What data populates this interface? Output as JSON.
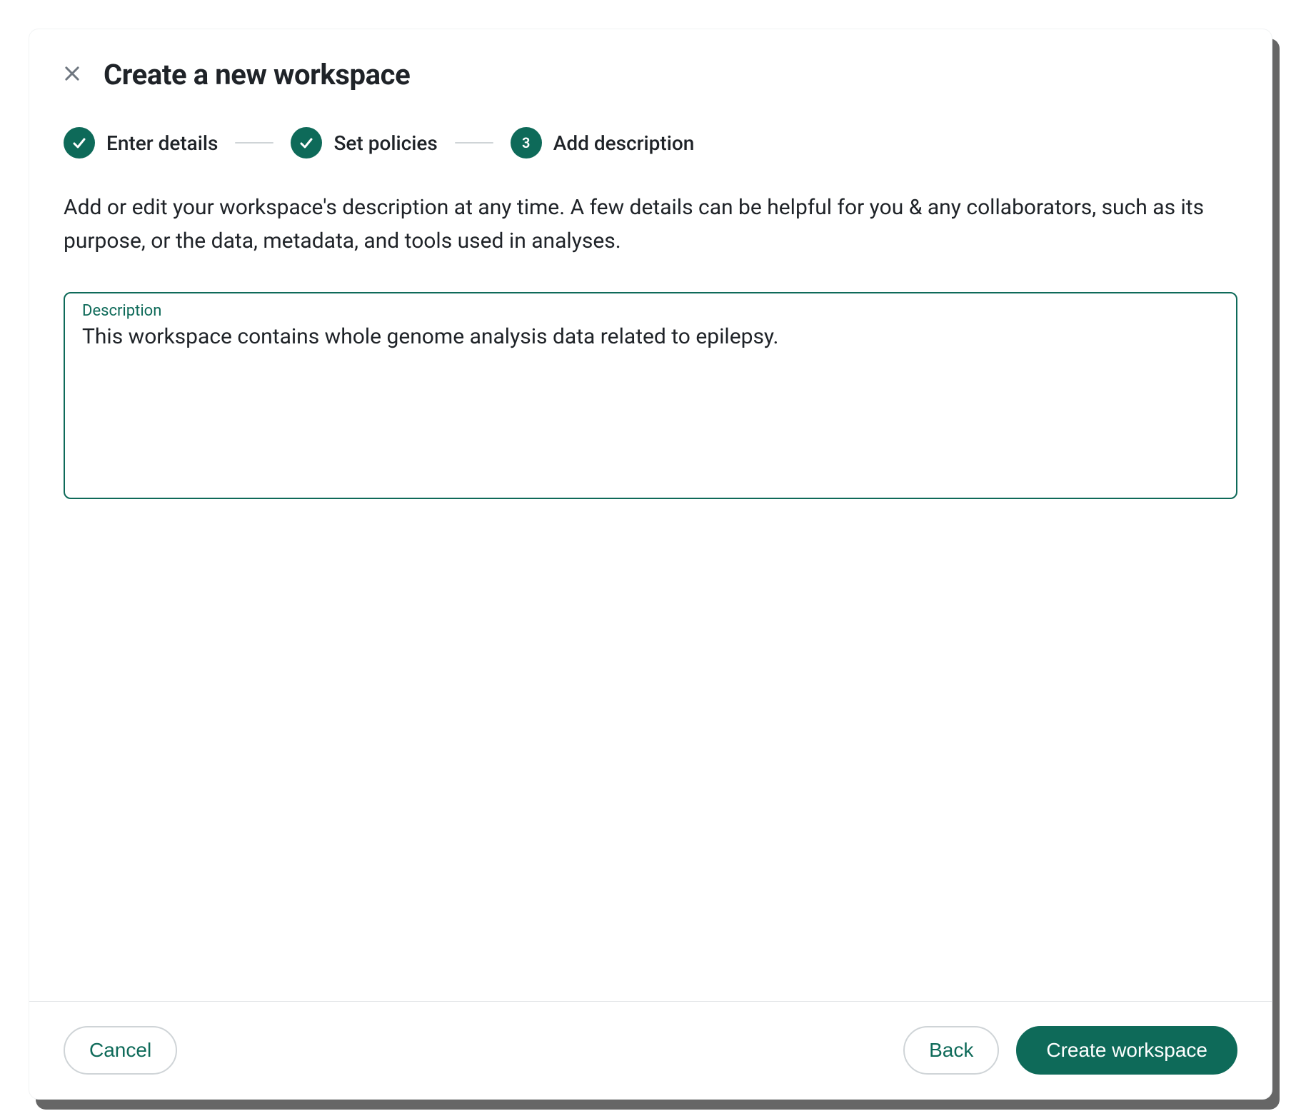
{
  "header": {
    "title": "Create a new workspace"
  },
  "stepper": {
    "steps": [
      {
        "label": "Enter details",
        "badge": "check"
      },
      {
        "label": "Set policies",
        "badge": "check"
      },
      {
        "label": "Add description",
        "badge": "3"
      }
    ]
  },
  "body": {
    "helper_text": "Add or edit your workspace's description at any time. A few details can be helpful for you & any collaborators, such as its purpose, or the data, metadata, and tools used in analyses.",
    "description_field": {
      "label": "Description",
      "value": "This workspace contains whole genome analysis data related to epilepsy.",
      "placeholder": ""
    }
  },
  "footer": {
    "cancel_label": "Cancel",
    "back_label": "Back",
    "submit_label": "Create workspace"
  }
}
